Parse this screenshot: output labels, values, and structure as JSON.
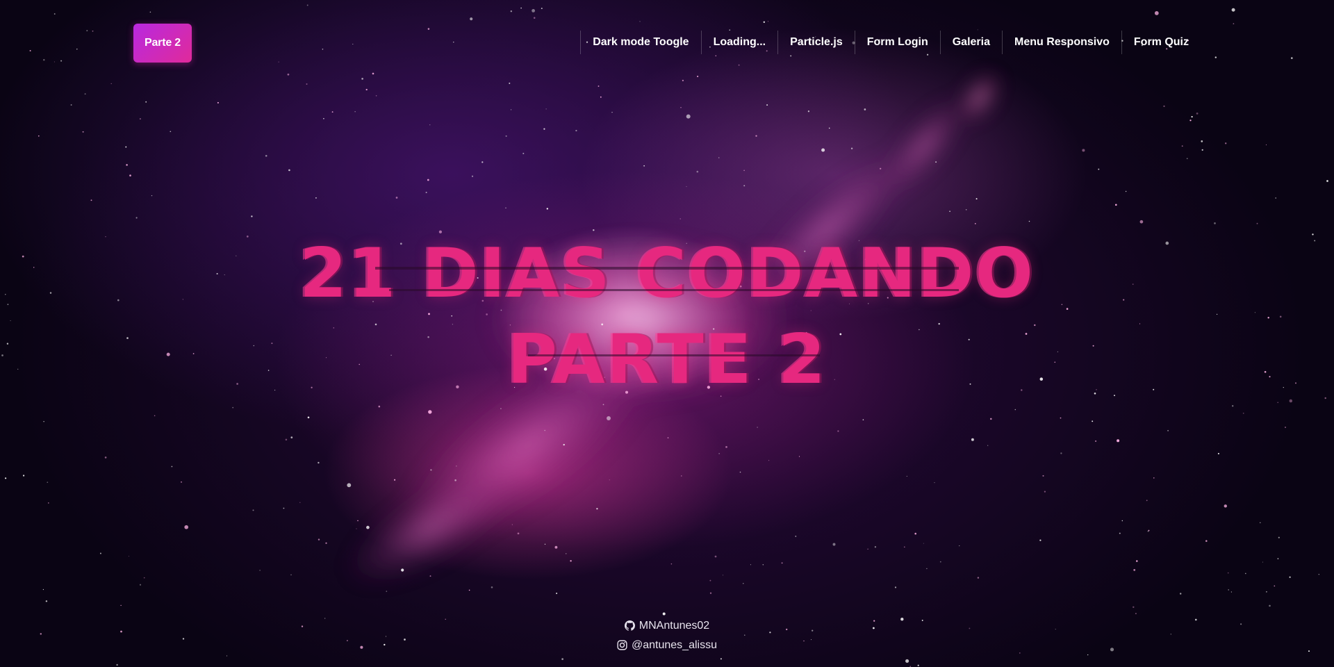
{
  "header": {
    "brand_label": "Parte 2",
    "nav": [
      {
        "label": "Dark mode Toogle",
        "name": "nav-dark-mode-toggle"
      },
      {
        "label": "Loading...",
        "name": "nav-loading"
      },
      {
        "label": "Particle.js",
        "name": "nav-particle-js"
      },
      {
        "label": "Form Login",
        "name": "nav-form-login"
      },
      {
        "label": "Galeria",
        "name": "nav-galeria"
      },
      {
        "label": "Menu Responsivo",
        "name": "nav-menu-responsivo"
      },
      {
        "label": "Form Quiz",
        "name": "nav-form-quiz"
      }
    ]
  },
  "hero": {
    "line1": "21 DIAS CODANDO",
    "line2": "PARTE 2"
  },
  "footer": {
    "github": {
      "icon": "github-icon",
      "label": "MNAntunes02"
    },
    "instagram": {
      "icon": "instagram-icon",
      "label": "@antunes_alissu"
    }
  },
  "colors": {
    "brand_gradient_start": "#b829e0",
    "brand_gradient_end": "#e02a9a",
    "hero_text": "#e6287f",
    "nav_text": "#ffffff"
  }
}
